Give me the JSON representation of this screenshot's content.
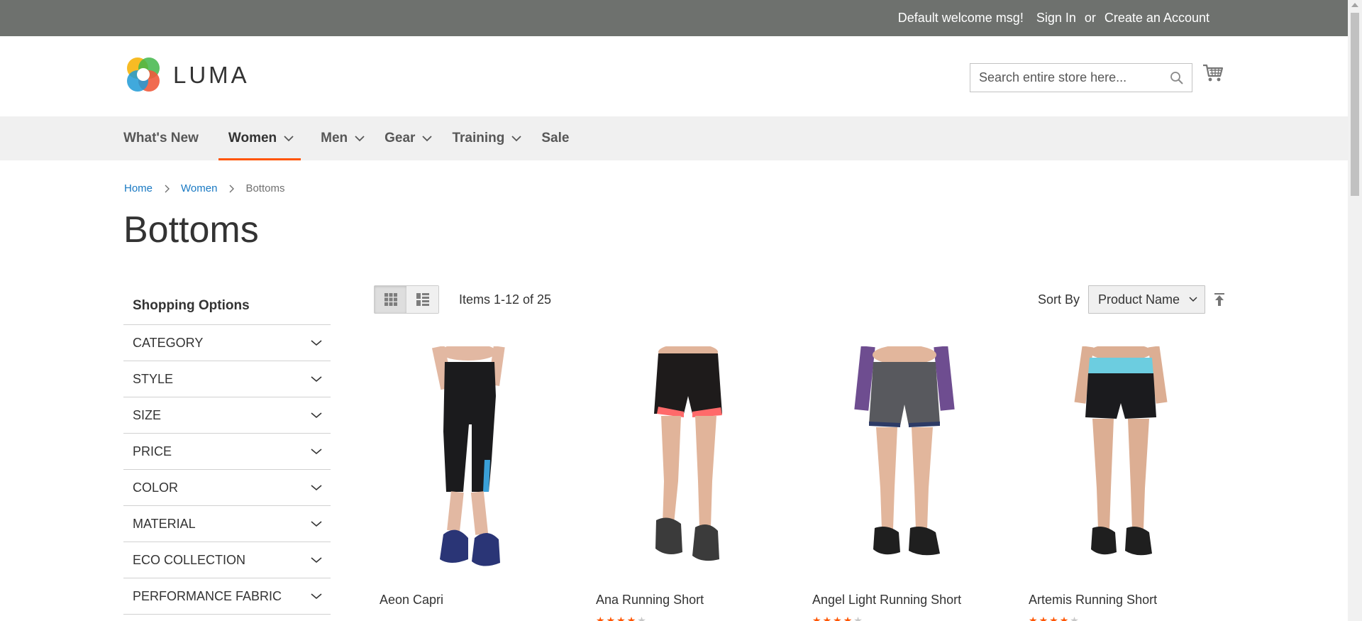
{
  "top_bar": {
    "welcome": "Default welcome msg!",
    "sign_in": "Sign In",
    "or": "or",
    "create_account": "Create an Account"
  },
  "header": {
    "logo_text": "LUMA",
    "search_placeholder": "Search entire store here...",
    "cart_icon": "cart-icon",
    "search_icon": "search-icon"
  },
  "nav": {
    "items": [
      {
        "label": "What's New",
        "has_dropdown": false,
        "active": false
      },
      {
        "label": "Women",
        "has_dropdown": true,
        "active": true
      },
      {
        "label": "Men",
        "has_dropdown": true,
        "active": false
      },
      {
        "label": "Gear",
        "has_dropdown": true,
        "active": false
      },
      {
        "label": "Training",
        "has_dropdown": true,
        "active": false
      },
      {
        "label": "Sale",
        "has_dropdown": false,
        "active": false
      }
    ],
    "active_color": "#ff5501"
  },
  "breadcrumb": {
    "items": [
      "Home",
      "Women",
      "Bottoms"
    ]
  },
  "page": {
    "title": "Bottoms"
  },
  "sidebar": {
    "title": "Shopping Options",
    "filters": [
      "CATEGORY",
      "STYLE",
      "SIZE",
      "PRICE",
      "COLOR",
      "MATERIAL",
      "ECO COLLECTION",
      "PERFORMANCE FABRIC"
    ]
  },
  "toolbar": {
    "items_count": "Items 1-12 of 25",
    "sort_label": "Sort By",
    "sort_value": "Product Name",
    "view_modes": [
      "grid",
      "list"
    ],
    "active_mode": "grid"
  },
  "products": [
    {
      "name": "Aeon Capri",
      "rating": 0
    },
    {
      "name": "Ana Running Short",
      "rating": 4
    },
    {
      "name": "Angel Light Running Short",
      "rating": 4
    },
    {
      "name": "Artemis Running Short",
      "rating": 4
    }
  ],
  "colors": {
    "top_bar": "#6e716e",
    "link": "#1979c3",
    "accent": "#ff5501",
    "nav_bg": "#f0f0f0"
  }
}
